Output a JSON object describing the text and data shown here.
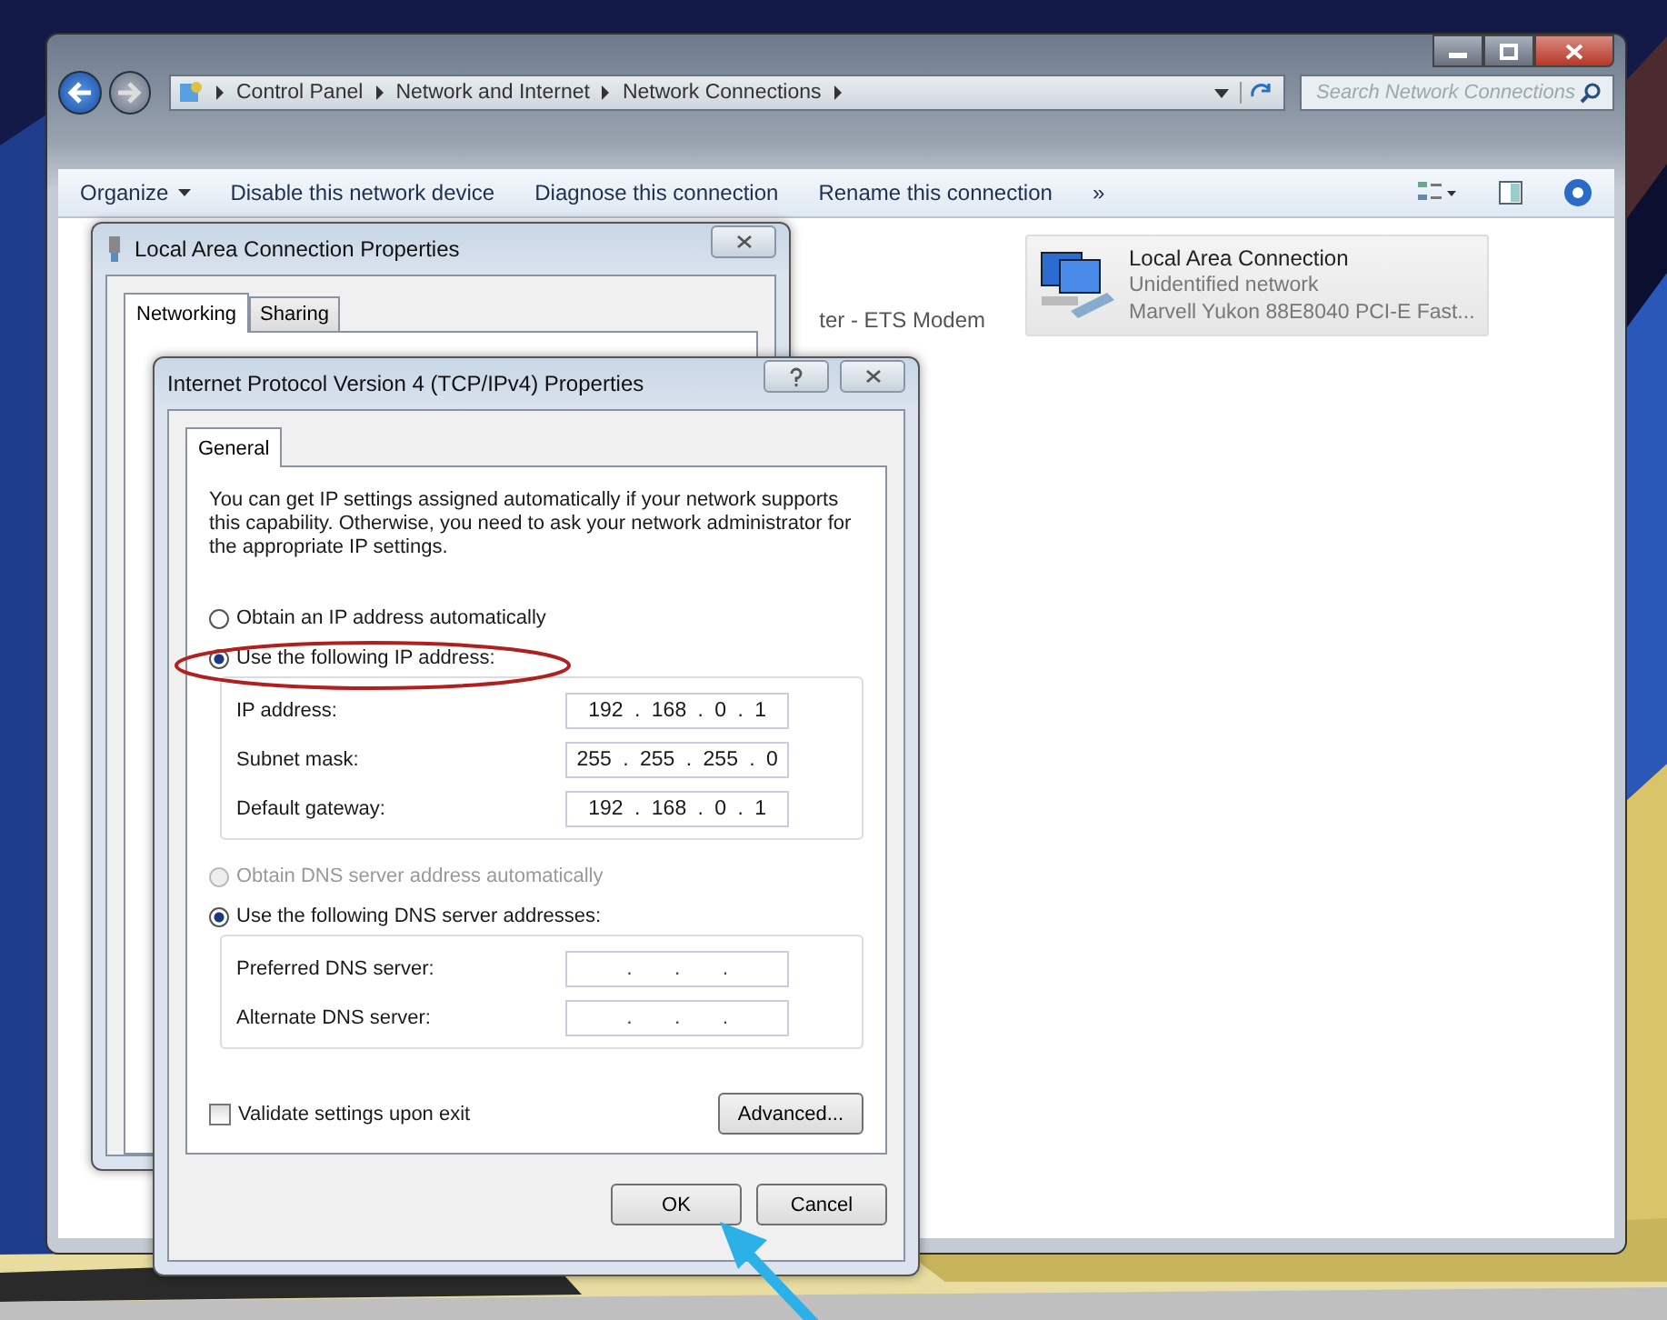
{
  "explorer": {
    "breadcrumb": [
      "Control Panel",
      "Network and Internet",
      "Network Connections"
    ],
    "search": {
      "placeholder": "Search Network Connections"
    },
    "toolbar": [
      "Organize",
      "Disable this network device",
      "Diagnose this connection",
      "Rename this connection",
      "»"
    ],
    "partial_text": "ter - ETS Modem",
    "connections": [
      {
        "title": "Local Area Connection",
        "status": "Unidentified network",
        "adapter": "Marvell Yukon 88E8040 PCI-E Fast..."
      }
    ]
  },
  "properties_dialog": {
    "title": "Local Area Connection Properties",
    "tabs": [
      {
        "label": "Networking",
        "selected": true
      },
      {
        "label": "Sharing",
        "selected": false
      }
    ]
  },
  "ipv4_dialog": {
    "title": "Internet Protocol Version 4 (TCP/IPv4) Properties",
    "tabs": [
      {
        "label": "General",
        "selected": true
      }
    ],
    "description": "You can get IP settings assigned automatically if your network supports this capability. Otherwise, you need to ask your network administrator for the appropriate IP settings.",
    "ip_mode": [
      {
        "label": "Obtain an IP address automatically",
        "selected": false,
        "disabled": false
      },
      {
        "label": "Use the following IP address:",
        "selected": true,
        "disabled": false
      }
    ],
    "ip_fields": [
      {
        "label": "IP address:",
        "value": "192 . 168 . 0 . 1"
      },
      {
        "label": "Subnet mask:",
        "value": "255 . 255 . 255 . 0"
      },
      {
        "label": "Default gateway:",
        "value": "192 . 168 . 0 . 1"
      }
    ],
    "dns_mode": [
      {
        "label": "Obtain DNS server address automatically",
        "selected": false,
        "disabled": true
      },
      {
        "label": "Use the following DNS server addresses:",
        "selected": true,
        "disabled": false
      }
    ],
    "dns_fields": [
      {
        "label": "Preferred DNS server:",
        "value": ". . ."
      },
      {
        "label": "Alternate DNS server:",
        "value": ". . ."
      }
    ],
    "validate": {
      "label": "Validate settings upon exit",
      "checked": false
    },
    "advanced_button": "Advanced...",
    "buttons": [
      "OK",
      "Cancel"
    ]
  }
}
